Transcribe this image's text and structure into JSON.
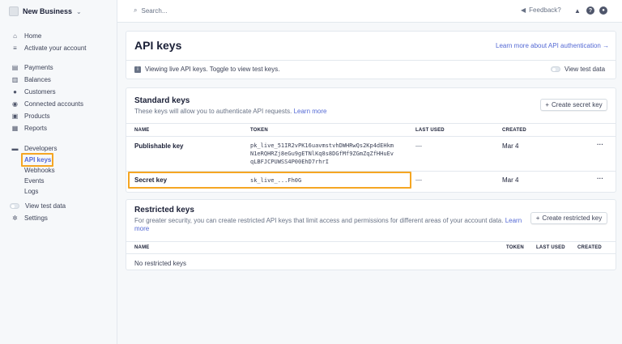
{
  "sidebar": {
    "account_name": "New Business",
    "items": [
      {
        "label": "Home",
        "icon": "home-icon"
      },
      {
        "label": "Activate your account",
        "icon": "checklist-icon"
      },
      {
        "label": "Payments",
        "icon": "payments-icon"
      },
      {
        "label": "Balances",
        "icon": "balances-icon"
      },
      {
        "label": "Customers",
        "icon": "customers-icon"
      },
      {
        "label": "Connected accounts",
        "icon": "connected-accounts-icon"
      },
      {
        "label": "Products",
        "icon": "products-icon"
      },
      {
        "label": "Reports",
        "icon": "reports-icon"
      },
      {
        "label": "Developers",
        "icon": "developers-icon"
      }
    ],
    "developer_subitems": [
      "API keys",
      "Webhooks",
      "Events",
      "Logs"
    ],
    "view_test_data": "View test data",
    "settings": "Settings"
  },
  "topbar": {
    "search_placeholder": "Search...",
    "feedback": "Feedback?"
  },
  "page": {
    "title": "API keys",
    "learn_more_auth": "Learn more about API authentication →",
    "banner_text": "Viewing live API keys. Toggle to view test keys.",
    "view_test_data": "View test data"
  },
  "standard_keys": {
    "title": "Standard keys",
    "description": "These keys will allow you to authenticate API requests.",
    "learn_more": "Learn more",
    "create_button": "Create secret key",
    "columns": [
      "NAME",
      "TOKEN",
      "LAST USED",
      "CREATED"
    ],
    "rows": [
      {
        "name": "Publishable key",
        "token_lines": [
          "pk_live_51IR2vPK16uavmstvhDWHRwQs2Kp4dEHkm",
          "N1eRQHRZj8eGu9gETNlKq8s8DGfMf9ZGmZqZfHHuEv",
          "qLBFJCPUWSS4P00EhD7rhrI"
        ],
        "last_used": "—",
        "created": "Mar 4"
      },
      {
        "name": "Secret key",
        "token_lines": [
          "sk_live_...Fh0G"
        ],
        "last_used": "—",
        "created": "Mar 4"
      }
    ]
  },
  "restricted_keys": {
    "title": "Restricted keys",
    "description_line1": "For greater security, you can create restricted API keys that limit access and permissions for different areas of your account data.",
    "learn_line1": "Learn",
    "learn_line2": "more",
    "create_button": "Create restricted key",
    "columns": [
      "NAME",
      "TOKEN",
      "LAST USED",
      "CREATED"
    ],
    "empty_text": "No restricted keys"
  },
  "colors": {
    "accent": "#5469d4",
    "highlight": "#f5a623"
  }
}
